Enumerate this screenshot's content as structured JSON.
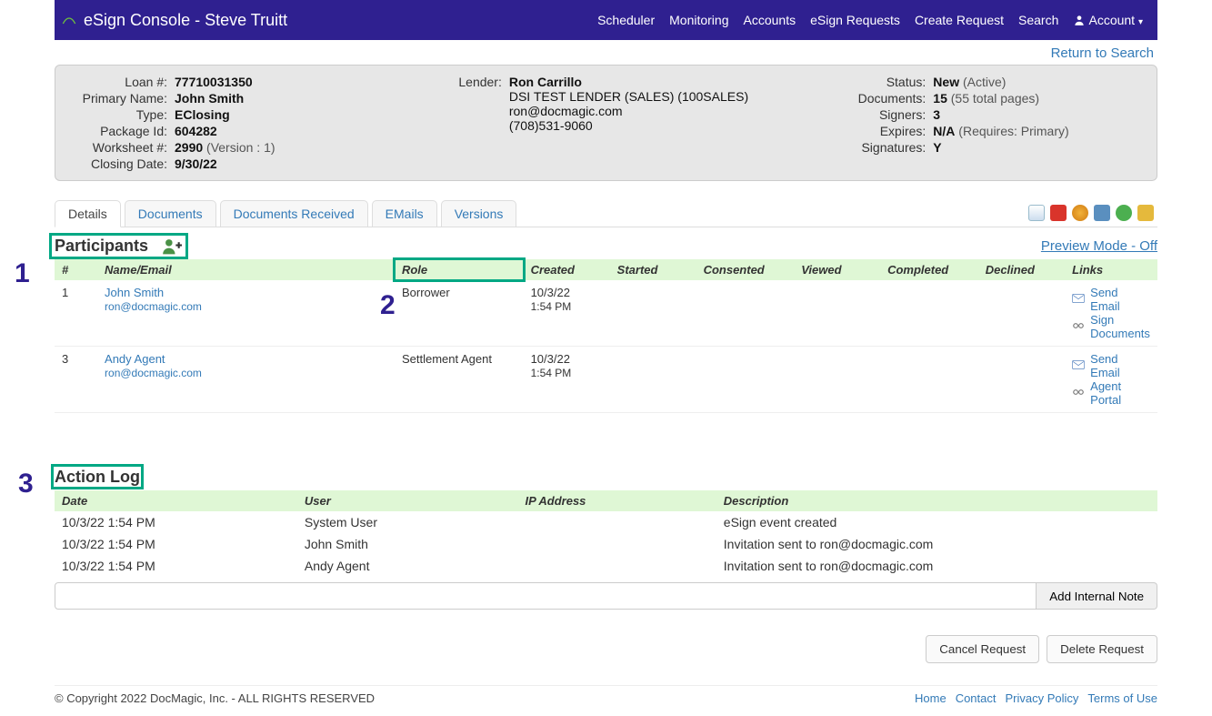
{
  "navbar": {
    "brand": "eSign Console - Steve Truitt",
    "links": [
      "Scheduler",
      "Monitoring",
      "Accounts",
      "eSign Requests",
      "Create Request",
      "Search"
    ],
    "account_label": "Account"
  },
  "return_to_search": "Return to Search",
  "info": {
    "col1": [
      {
        "label": "Loan #:",
        "value": "77710031350",
        "bold": true
      },
      {
        "label": "Primary Name:",
        "value": "John Smith",
        "bold": true
      },
      {
        "label": "Type:",
        "value": "EClosing",
        "bold": true
      },
      {
        "label": "Package Id:",
        "value": "604282",
        "bold": true
      },
      {
        "label": "Worksheet #:",
        "value": "2990",
        "bold": true,
        "extra": " (Version : 1)"
      },
      {
        "label": "Closing Date:",
        "value": "9/30/22",
        "bold": true
      }
    ],
    "col2_label": "Lender:",
    "col2": {
      "name": "Ron Carrillo",
      "company": "DSI TEST LENDER (SALES) (100SALES)",
      "email": "ron@docmagic.com",
      "phone": "(708)531-9060"
    },
    "col3": [
      {
        "label": "Status:",
        "value": "New",
        "bold": true,
        "extra": " (Active)"
      },
      {
        "label": "Documents:",
        "value": "15",
        "bold": true,
        "extra": " (55 total pages)"
      },
      {
        "label": "Signers:",
        "value": "3",
        "bold": true
      },
      {
        "label": "Expires:",
        "value": "N/A",
        "bold": true,
        "extra": " (Requires: Primary)"
      },
      {
        "label": "Signatures:",
        "value": "Y",
        "bold": true
      }
    ]
  },
  "tabs": [
    "Details",
    "Documents",
    "Documents Received",
    "EMails",
    "Versions"
  ],
  "active_tab": 0,
  "participants_header": "Participants",
  "preview_mode": "Preview Mode - Off",
  "p_columns": [
    "#",
    "Name/Email",
    "Role",
    "Created",
    "Started",
    "Consented",
    "Viewed",
    "Completed",
    "Declined",
    "Links"
  ],
  "participants": [
    {
      "num": "1",
      "name": "John Smith",
      "email": "ron@docmagic.com",
      "role": "Borrower",
      "created": "10/3/22",
      "created_time": "1:54 PM",
      "links": [
        {
          "icon": "mail",
          "label": "Send Email"
        },
        {
          "icon": "link",
          "label": "Sign Documents"
        }
      ]
    },
    {
      "num": "3",
      "name": "Andy Agent",
      "email": "ron@docmagic.com",
      "role": "Settlement Agent",
      "created": "10/3/22",
      "created_time": "1:54 PM",
      "links": [
        {
          "icon": "mail",
          "label": "Send Email"
        },
        {
          "icon": "link",
          "label": "Agent Portal"
        }
      ]
    }
  ],
  "actionlog_header": "Action Log",
  "a_columns": [
    "Date",
    "User",
    "IP Address",
    "Description"
  ],
  "actions": [
    {
      "date": "10/3/22 1:54 PM",
      "user": "System User",
      "ip": "",
      "desc": "eSign event created"
    },
    {
      "date": "10/3/22 1:54 PM",
      "user": "John Smith",
      "ip": "",
      "desc": "Invitation sent to ron@docmagic.com"
    },
    {
      "date": "10/3/22 1:54 PM",
      "user": "Andy Agent",
      "ip": "",
      "desc": "Invitation sent to ron@docmagic.com"
    }
  ],
  "note_placeholder": "",
  "note_btn": "Add Internal Note",
  "btn_cancel": "Cancel Request",
  "btn_delete": "Delete Request",
  "footer": {
    "copyright": "© Copyright 2022 DocMagic, Inc. - ALL RIGHTS RESERVED",
    "links": [
      "Home",
      "Contact",
      "Privacy Policy",
      "Terms of Use"
    ]
  },
  "callouts": {
    "1": "1",
    "2": "2",
    "3": "3"
  }
}
